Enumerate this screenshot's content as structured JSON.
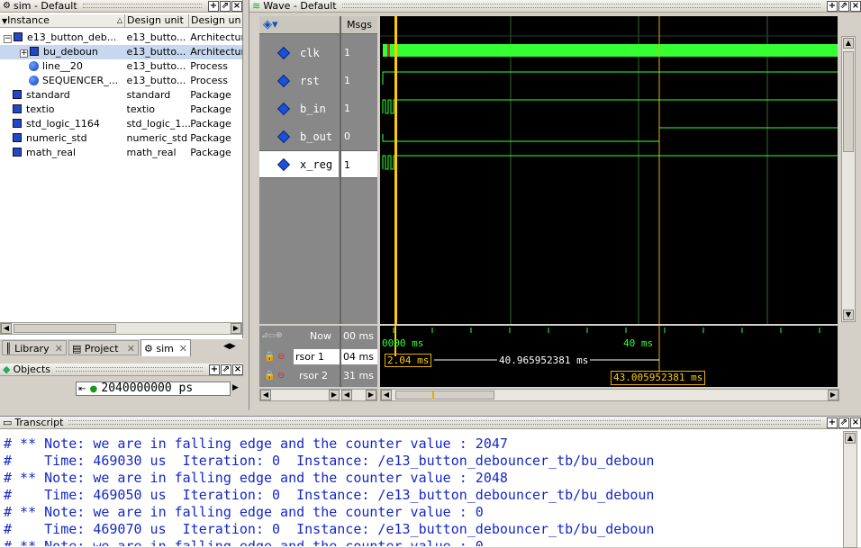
{
  "sim_panel": {
    "title": "sim - Default",
    "columns": [
      "Instance",
      "Design unit",
      "Design unit"
    ],
    "rows": [
      {
        "name": "e13_button_deb...",
        "unit": "e13_butto...",
        "type": "Architectur",
        "icon": "design-unit-icon",
        "expander": "−"
      },
      {
        "name": "bu_deboun",
        "unit": "e13_butto...",
        "type": "Architectur",
        "icon": "design-unit-icon",
        "expander": "+"
      },
      {
        "name": "line__20",
        "unit": "e13_butto...",
        "type": "Process",
        "icon": "process-icon"
      },
      {
        "name": "SEQUENCER_...",
        "unit": "e13_butto...",
        "type": "Process",
        "icon": "process-icon"
      },
      {
        "name": "standard",
        "unit": "standard",
        "type": "Package",
        "icon": "package-icon"
      },
      {
        "name": "textio",
        "unit": "textio",
        "type": "Package",
        "icon": "package-icon"
      },
      {
        "name": "std_logic_1164",
        "unit": "std_logic_1...",
        "type": "Package",
        "icon": "package-icon"
      },
      {
        "name": "numeric_std",
        "unit": "numeric_std",
        "type": "Package",
        "icon": "package-icon"
      },
      {
        "name": "math_real",
        "unit": "math_real",
        "type": "Package",
        "icon": "package-icon"
      }
    ]
  },
  "tabs": [
    {
      "label": "Library",
      "icon": "library-icon"
    },
    {
      "label": "Project",
      "icon": "project-icon"
    },
    {
      "label": "sim",
      "icon": "sim-icon"
    }
  ],
  "objects_panel": {
    "title": "Objects",
    "time_value": "2040000000 ps"
  },
  "wave_panel": {
    "title": "Wave - Default",
    "msgs_header": "Msgs",
    "signals": [
      {
        "name": "clk",
        "value": "1"
      },
      {
        "name": "rst",
        "value": "1"
      },
      {
        "name": "b_in",
        "value": "1"
      },
      {
        "name": "b_out",
        "value": "0"
      },
      {
        "name": "x_reg",
        "value": "1"
      }
    ],
    "now_label": "Now",
    "now_value": "00 ms",
    "cursors": [
      {
        "label": "rsor 1",
        "value": "04 ms",
        "time": "2.04 ms"
      },
      {
        "label": "rsor 2",
        "value": "31 ms",
        "time": "43.005952381 ms"
      }
    ],
    "ruler_start": "0000 ms",
    "ruler_mark": "40 ms",
    "delta": "40.965952381 ms",
    "colors": {
      "wave": "#33ff33",
      "cursor1": "#ffcc00",
      "cursor2": "#e8b000",
      "grid": "#2f6b2f"
    }
  },
  "transcript": {
    "title": "Transcript",
    "lines": [
      "# ** Note: we are in falling edge and the counter value : 2047",
      "#    Time: 469030 us  Iteration: 0  Instance: /e13_button_debouncer_tb/bu_deboun",
      "# ** Note: we are in falling edge and the counter value : 2048",
      "#    Time: 469050 us  Iteration: 0  Instance: /e13_button_debouncer_tb/bu_deboun",
      "# ** Note: we are in falling edge and the counter value : 0",
      "#    Time: 469070 us  Iteration: 0  Instance: /e13_button_debouncer_tb/bu_deboun",
      "# ** Note: we are in falling edge and the counter value : 0"
    ]
  }
}
